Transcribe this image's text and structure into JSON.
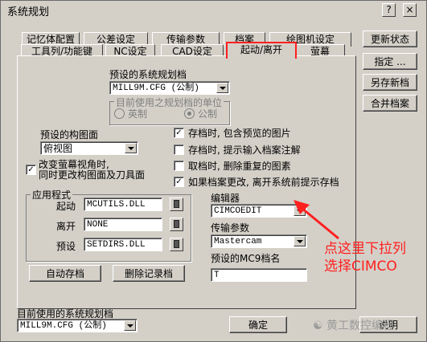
{
  "window": {
    "title": "系统规划"
  },
  "titlebar_buttons": [
    "?",
    "×"
  ],
  "tabs_row1": [
    "记忆体配置",
    "公差设定",
    "传输参数",
    "档案",
    "绘图机设定"
  ],
  "tabs_row2": [
    "工具列/功能键",
    "NC设定",
    "CAD设定",
    "起动/离开",
    "萤幕"
  ],
  "right_buttons": [
    "更新状态",
    "指定 ...",
    "另存新档",
    "合并档案"
  ],
  "preset_config": {
    "label": "预设的系统规划档",
    "value": "MILL9M.CFG (公制)"
  },
  "units": {
    "label": "目前使用之规划档的单位",
    "english": "英制",
    "metric": "公制"
  },
  "preset_view": {
    "label": "预设的构图面",
    "value": "俯视图"
  },
  "change_view": {
    "line1": "改变萤幕视角时,",
    "line2": "同时更改构图面及刀具面",
    "checked": true
  },
  "options": [
    {
      "label": "存档时, 包含预览的图片",
      "checked": true
    },
    {
      "label": "存档时, 提示输入档案注解",
      "checked": false
    },
    {
      "label": "取档时, 删除重复的图素",
      "checked": false
    },
    {
      "label": "如果档案更改, 离开系统前提示存档",
      "checked": true
    }
  ],
  "applications": {
    "title": "应用程式",
    "startup_label": "起动",
    "startup_value": "MCUTILS.DLL",
    "exit_label": "离开",
    "exit_value": "NONE",
    "default_label": "预设",
    "default_value": "SETDIRS.DLL"
  },
  "editor": {
    "label": "编辑器",
    "value": "CIMCOEDIT"
  },
  "transfer": {
    "label": "传输参数",
    "value": "Mastercam"
  },
  "mc9_name": {
    "label": "预设的MC9档名",
    "value": "T"
  },
  "panel_buttons": {
    "autosave": "自动存档",
    "delete_log": "删除记录档"
  },
  "current_config": {
    "label": "目前使用的系统规划档",
    "value": "MILL9M.CFG (公制)"
  },
  "bottom_buttons": {
    "ok": "确定",
    "help": "说明"
  },
  "annotation": {
    "line1": "点这里下拉列",
    "line2": "选择CIMCO"
  },
  "watermark": "黄工数控编程",
  "colors": {
    "face": "#d4d0c8",
    "highlight": "#ff2020"
  }
}
